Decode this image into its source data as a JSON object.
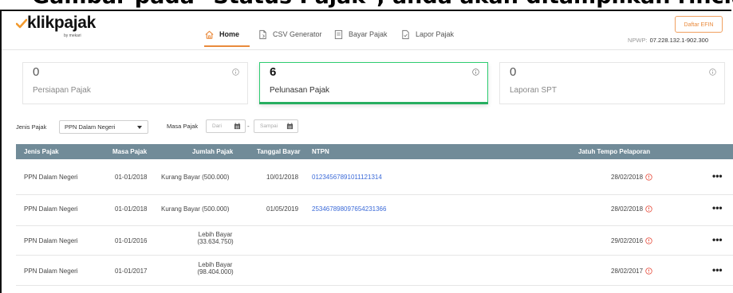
{
  "caption": "Gambar pada \"Status Pajak\", anda akan ditampilkan rincian pembayaran pajak",
  "header": {
    "logo_word": "klikpajak",
    "logo_by": "by mekari",
    "nav": [
      {
        "label": "Home",
        "icon": "home-icon",
        "active": true
      },
      {
        "label": "CSV Generator",
        "icon": "document-icon"
      },
      {
        "label": "Bayar Pajak",
        "icon": "receipt-icon"
      },
      {
        "label": "Lapor Pajak",
        "icon": "report-icon"
      }
    ],
    "efin_button": "Daftar EFIN",
    "npwp_label": "NPWP:",
    "npwp_value": "07.228.132.1-902.300"
  },
  "cards": [
    {
      "count": "0",
      "label": "Persiapan Pajak"
    },
    {
      "count": "6",
      "label": "Pelunasan Pajak",
      "active": true
    },
    {
      "count": "0",
      "label": "Laporan SPT"
    }
  ],
  "filters": {
    "jenis_label": "Jenis Pajak",
    "jenis_value": "PPN Dalam Negeri",
    "masa_label": "Masa Pajak",
    "dari_placeholder": "Dari",
    "sampai_placeholder": "Sampai",
    "separator": "-"
  },
  "table": {
    "headers": {
      "jenis": "Jenis Pajak",
      "masa": "Masa Pajak",
      "jumlah": "Jumlah Pajak",
      "tanggal": "Tanggal Bayar",
      "ntpn": "NTPN",
      "jatuh": "Jatuh Tempo Pelaporan"
    },
    "rows": [
      {
        "jenis": "PPN Dalam Negeri",
        "masa": "01-01/2018",
        "jumlah": "Kurang Bayar (500.000)",
        "jumlah2": "",
        "tanggal": "10/01/2018",
        "ntpn": "01234567891011121314",
        "jatuh": "28/02/2018"
      },
      {
        "jenis": "PPN Dalam Negeri",
        "masa": "01-01/2018",
        "jumlah": "Kurang Bayar (500.000)",
        "jumlah2": "",
        "tanggal": "01/05/2019",
        "ntpn": "253467898097654231366",
        "jatuh": "28/02/2018"
      },
      {
        "jenis": "PPN Dalam Negeri",
        "masa": "01-01/2016",
        "jumlah": "Lebih Bayar",
        "jumlah2": "(33.634.750)",
        "tanggal": "",
        "ntpn": "",
        "jatuh": "29/02/2016"
      },
      {
        "jenis": "PPN Dalam Negeri",
        "masa": "01-01/2017",
        "jumlah": "Lebih Bayar",
        "jumlah2": "(98.404.000)",
        "tanggal": "",
        "ntpn": "",
        "jatuh": "28/02/2017"
      }
    ],
    "more_glyph": "•••"
  },
  "colors": {
    "accent_orange": "#e98a3c",
    "active_green": "#27ae60",
    "table_header": "#718b98",
    "link_blue": "#3b6ad8",
    "warn_red": "#e74c3c"
  }
}
